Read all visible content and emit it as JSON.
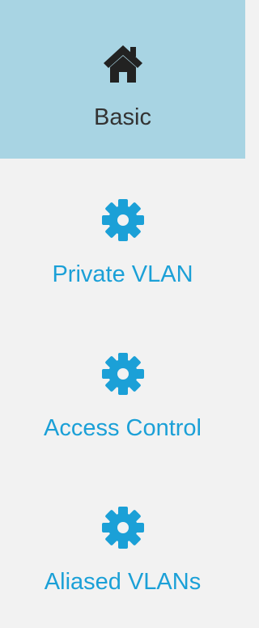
{
  "colors": {
    "active_background": "#a8d4e3",
    "sidebar_background": "#f2f2f2",
    "active_text": "#333333",
    "link_text": "#1ba0d7",
    "active_icon": "#222222",
    "link_icon": "#1ba0d7"
  },
  "sidebar": {
    "items": [
      {
        "label": "Basic",
        "icon": "home-icon",
        "active": true
      },
      {
        "label": "Private VLAN",
        "icon": "gear-icon",
        "active": false
      },
      {
        "label": "Access Control",
        "icon": "gear-icon",
        "active": false
      },
      {
        "label": "Aliased VLANs",
        "icon": "gear-icon",
        "active": false
      }
    ]
  }
}
